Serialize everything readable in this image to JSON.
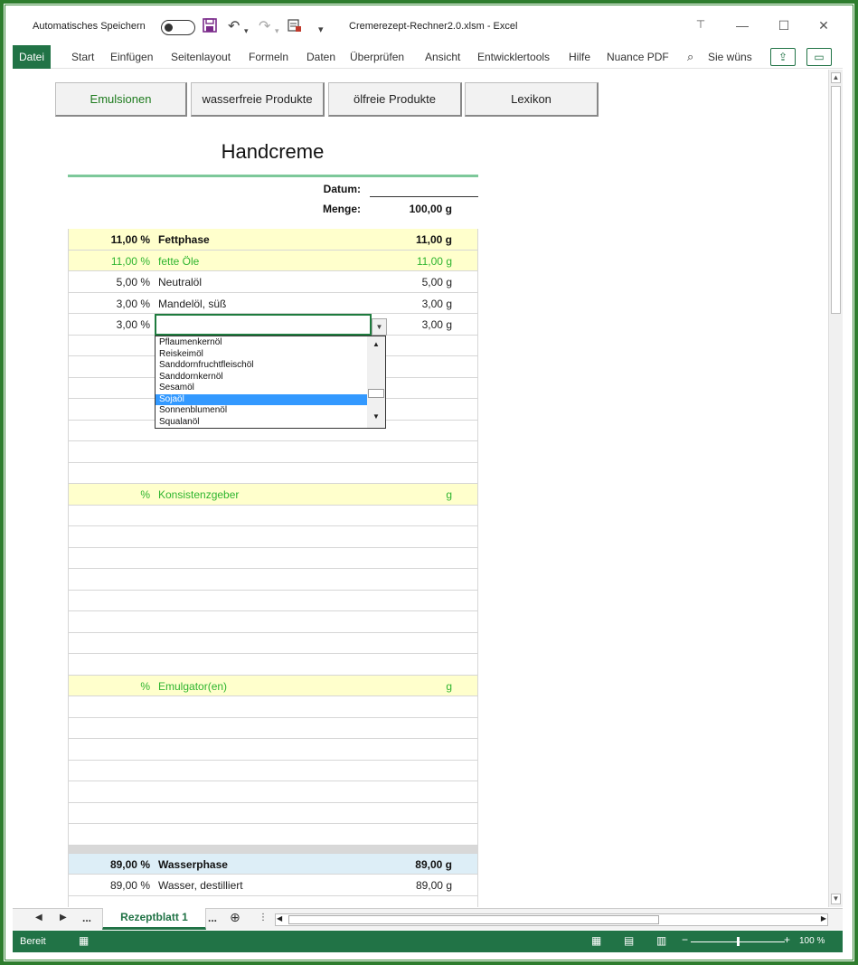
{
  "titlebar": {
    "autosave_label": "Automatisches Speichern",
    "document_title": "Cremerezept-Rechner2.0.xlsm  -  Excel"
  },
  "ribbon": {
    "tabs": [
      "Datei",
      "Start",
      "Einfügen",
      "Seitenlayout",
      "Formeln",
      "Daten",
      "Überprüfen",
      "Ansicht",
      "Entwicklertools",
      "Hilfe",
      "Nuance PDF"
    ],
    "search_label": "Sie wüns"
  },
  "nav_buttons": [
    {
      "label": "Emulsionen",
      "active": true
    },
    {
      "label": "wasserfreie Produkte",
      "active": false
    },
    {
      "label": "ölfreie Produkte",
      "active": false
    },
    {
      "label": "Lexikon",
      "active": false
    }
  ],
  "recipe": {
    "title": "Handcreme",
    "datum_label": "Datum:",
    "datum_value": "",
    "menge_label": "Menge:",
    "menge_value": "100,00 g"
  },
  "rows": [
    {
      "pct": "11,00 %",
      "name": "Fettphase",
      "amt": "11,00 g",
      "style": "yellow bold"
    },
    {
      "pct": "11,00 %",
      "name": "fette Öle",
      "amt": "11,00 g",
      "style": "yellow green"
    },
    {
      "pct": "5,00 %",
      "name": "Neutralöl",
      "amt": "5,00 g",
      "style": ""
    },
    {
      "pct": "3,00 %",
      "name": "Mandelöl, süß",
      "amt": "3,00 g",
      "style": ""
    },
    {
      "pct": "3,00 %",
      "name": "",
      "amt": "3,00 g",
      "style": ""
    },
    {
      "pct": "",
      "name": "",
      "amt": "",
      "style": ""
    },
    {
      "pct": "",
      "name": "",
      "amt": "",
      "style": ""
    },
    {
      "pct": "",
      "name": "",
      "amt": "",
      "style": ""
    },
    {
      "pct": "",
      "name": "",
      "amt": "",
      "style": ""
    },
    {
      "pct": "",
      "name": "",
      "amt": "",
      "style": ""
    },
    {
      "pct": "",
      "name": "",
      "amt": "",
      "style": ""
    },
    {
      "pct": "",
      "name": "",
      "amt": "",
      "style": ""
    },
    {
      "pct": "%",
      "name": "Konsistenzgeber",
      "amt": "g",
      "style": "yellow green"
    },
    {
      "pct": "",
      "name": "",
      "amt": "",
      "style": ""
    },
    {
      "pct": "",
      "name": "",
      "amt": "",
      "style": ""
    },
    {
      "pct": "",
      "name": "",
      "amt": "",
      "style": ""
    },
    {
      "pct": "",
      "name": "",
      "amt": "",
      "style": ""
    },
    {
      "pct": "",
      "name": "",
      "amt": "",
      "style": ""
    },
    {
      "pct": "",
      "name": "",
      "amt": "",
      "style": ""
    },
    {
      "pct": "",
      "name": "",
      "amt": "",
      "style": ""
    },
    {
      "pct": "",
      "name": "",
      "amt": "",
      "style": ""
    },
    {
      "pct": "%",
      "name": "Emulgator(en)",
      "amt": "g",
      "style": "yellow green"
    },
    {
      "pct": "",
      "name": "",
      "amt": "",
      "style": ""
    },
    {
      "pct": "",
      "name": "",
      "amt": "",
      "style": ""
    },
    {
      "pct": "",
      "name": "",
      "amt": "",
      "style": ""
    },
    {
      "pct": "",
      "name": "",
      "amt": "",
      "style": ""
    },
    {
      "pct": "",
      "name": "",
      "amt": "",
      "style": ""
    },
    {
      "pct": "",
      "name": "",
      "amt": "",
      "style": ""
    },
    {
      "pct": "",
      "name": "",
      "amt": "",
      "style": ""
    },
    {
      "pct": "",
      "name": "",
      "amt": "",
      "style": "gray"
    },
    {
      "pct": "89,00 %",
      "name": "Wasserphase",
      "amt": "89,00 g",
      "style": "blue bold"
    },
    {
      "pct": "89,00 %",
      "name": "Wasser, destilliert",
      "amt": "89,00 g",
      "style": ""
    },
    {
      "pct": "",
      "name": "",
      "amt": "",
      "style": ""
    }
  ],
  "dropdown": {
    "items": [
      "Pflaumenkernöl",
      "Reiskeimöl",
      "Sanddornfruchtfleischöl",
      "Sanddornkernöl",
      "Sesamöl",
      "Sojaöl",
      "Sonnenblumenöl",
      "Squalanöl"
    ],
    "selected": "Sojaöl"
  },
  "sheet_tabs": {
    "active": "Rezeptblatt 1",
    "ellipsis_left": "...",
    "ellipsis_right": "..."
  },
  "status": {
    "ready": "Bereit",
    "zoom": "100 %"
  },
  "colors": {
    "excel_green": "#217346",
    "section_yellow": "#ffffcc",
    "water_blue": "#ddeef7",
    "accent_text_green": "#2fb52f",
    "selection_blue": "#3399ff"
  }
}
